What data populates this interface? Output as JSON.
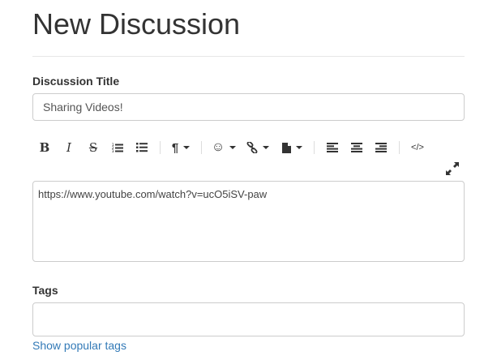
{
  "page": {
    "title": "New Discussion"
  },
  "discussion_title": {
    "label": "Discussion Title",
    "value": "Sharing Videos!"
  },
  "toolbar": {
    "buttons": [
      {
        "name": "bold-icon",
        "glyph": "B"
      },
      {
        "name": "italic-icon",
        "glyph": "I"
      },
      {
        "name": "strikethrough-icon",
        "glyph": "S"
      },
      {
        "name": "ordered-list-icon"
      },
      {
        "name": "unordered-list-icon"
      },
      {
        "name": "paragraph-icon",
        "glyph": "¶",
        "dropdown": true
      },
      {
        "name": "emoji-icon",
        "glyph": "☺",
        "dropdown": true
      },
      {
        "name": "link-icon",
        "dropdown": true
      },
      {
        "name": "file-icon",
        "dropdown": true
      },
      {
        "name": "align-left-icon"
      },
      {
        "name": "align-center-icon"
      },
      {
        "name": "align-right-icon"
      },
      {
        "name": "code-view-icon",
        "glyph": "</>"
      }
    ],
    "expand_icon": "expand-icon"
  },
  "editor": {
    "content": "https://www.youtube.com/watch?v=ucO5iSV-paw"
  },
  "tags": {
    "label": "Tags",
    "value": "",
    "placeholder": ""
  },
  "popular_tags_link": "Show popular tags",
  "colors": {
    "link": "#337ab7",
    "border": "#cccccc",
    "text": "#333333"
  }
}
